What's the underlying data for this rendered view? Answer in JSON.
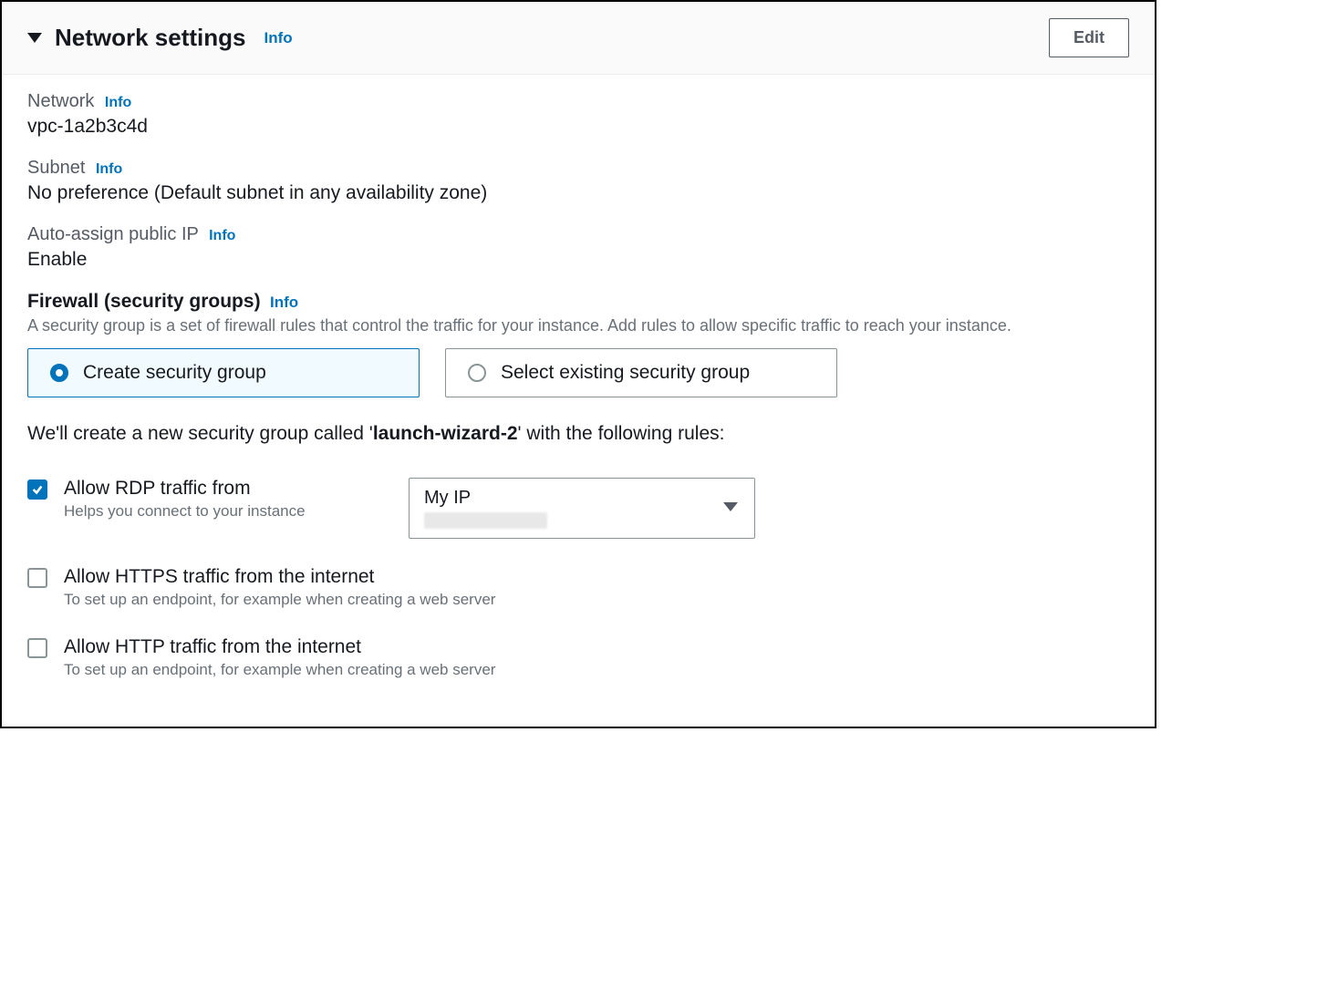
{
  "header": {
    "title": "Network settings",
    "info": "Info",
    "edit": "Edit"
  },
  "network": {
    "label": "Network",
    "info": "Info",
    "value": "vpc-1a2b3c4d"
  },
  "subnet": {
    "label": "Subnet",
    "info": "Info",
    "value": "No preference (Default subnet in any availability zone)"
  },
  "publicIp": {
    "label": "Auto-assign public IP",
    "info": "Info",
    "value": "Enable"
  },
  "firewall": {
    "heading": "Firewall (security groups)",
    "info": "Info",
    "description": "A security group is a set of firewall rules that control the traffic for your instance. Add rules to allow specific traffic to reach your instance.",
    "options": {
      "create": "Create security group",
      "select": "Select existing security group"
    },
    "createTextPrefix": "We'll create a new security group called '",
    "groupName": "launch-wizard-2",
    "createTextSuffix": "' with the following rules:"
  },
  "rules": {
    "rdp": {
      "label": "Allow RDP traffic from",
      "help": "Helps you connect to your instance",
      "checked": true,
      "sourceLabel": "My IP"
    },
    "https": {
      "label": "Allow HTTPS traffic from the internet",
      "help": "To set up an endpoint, for example when creating a web server",
      "checked": false
    },
    "http": {
      "label": "Allow HTTP traffic from the internet",
      "help": "To set up an endpoint, for example when creating a web server",
      "checked": false
    }
  }
}
